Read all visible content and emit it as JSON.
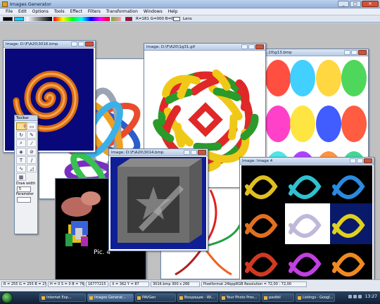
{
  "app": {
    "title": "Images Generator",
    "window_buttons": [
      "_",
      "□",
      "✕"
    ]
  },
  "menu": [
    "File",
    "Edit",
    "Options",
    "Tools",
    "Effect",
    "Filters",
    "Transformation",
    "Windows",
    "Help"
  ],
  "toolbar": {
    "rgb_readout": "R=181 G=000 B=049",
    "lens_label": "Lens"
  },
  "documents": [
    {
      "title": "Image: D:\\F\\A20\\3016.bmp"
    },
    {
      "title": "Image: D:\\F\\A20\\1g31.gif"
    },
    {
      "title": "...20\\g13.bmp"
    },
    {
      "title": "Image: D:\\F\\A20\\3014.bmp"
    },
    {
      "title": "Image: Image 4"
    }
  ],
  "pic_caption": "Pic. 4",
  "toolbox": {
    "title": "Toolbar",
    "draw_width_label": "Draw width",
    "draw_width_value": "5",
    "parameter_label": "Parameter"
  },
  "status": {
    "rgb": "R = 255  G = 255  B = 255",
    "hsv": "H = 0 S = 0 B = 765",
    "code": "16777215",
    "coords": "X = 362    Y = 87",
    "file": "3016.bmp   300 x 266",
    "pixel": "Pixelformat 24bppRGB   Resolution = 72,00 : 72,00"
  },
  "taskbar": {
    "items": [
      "Internet Exp...",
      "Images Generat...",
      "PAVGen",
      "Входящие - Wi...",
      "Your Photo Pres...",
      "pastbil",
      "Listings - Googl..."
    ],
    "clock": "13:27"
  },
  "colors": {
    "app_bg": "#c6d3e3",
    "workspace": "#c0c0c0",
    "accent_red": "#b50031"
  }
}
